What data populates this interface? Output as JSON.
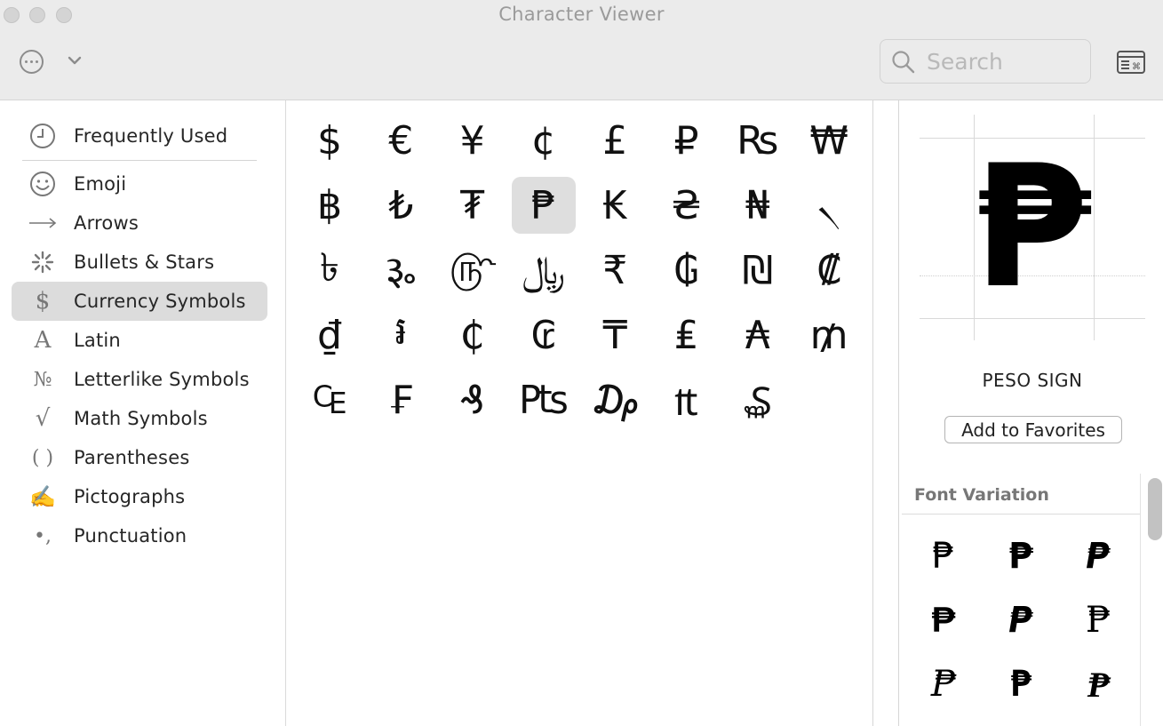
{
  "window": {
    "title": "Character Viewer"
  },
  "toolbar": {
    "action_icon": "ellipsis-circle-icon",
    "chevron_icon": "chevron-down-icon",
    "search_placeholder": "Search",
    "search_value": "",
    "keyboard_icon": "keyboard-viewer-icon"
  },
  "sidebar": {
    "items": [
      {
        "label": "Frequently Used",
        "icon": "clock-icon",
        "glyph": "🕘",
        "selected": false
      },
      {
        "label": "Emoji",
        "icon": "smiley-icon",
        "glyph": "☺",
        "selected": false
      },
      {
        "label": "Arrows",
        "icon": "arrow-right-icon",
        "glyph": "⟶",
        "selected": false
      },
      {
        "label": "Bullets & Stars",
        "icon": "asterisk-icon",
        "glyph": "✻",
        "selected": false
      },
      {
        "label": "Currency Symbols",
        "icon": "dollar-icon",
        "glyph": "$",
        "selected": true
      },
      {
        "label": "Latin",
        "icon": "latin-a-icon",
        "glyph": "A",
        "selected": false
      },
      {
        "label": "Letterlike Symbols",
        "icon": "numero-icon",
        "glyph": "№",
        "selected": false
      },
      {
        "label": "Math Symbols",
        "icon": "square-root-icon",
        "glyph": "√",
        "selected": false
      },
      {
        "label": "Parentheses",
        "icon": "parentheses-icon",
        "glyph": "( )",
        "selected": false
      },
      {
        "label": "Pictographs",
        "icon": "writing-hand-icon",
        "glyph": "✍",
        "selected": false
      },
      {
        "label": "Punctuation",
        "icon": "punctuation-icon",
        "glyph": "•,",
        "selected": false
      }
    ]
  },
  "grid": {
    "characters": [
      "$",
      "€",
      "¥",
      "¢",
      "£",
      "₽",
      "₨",
      "₩",
      "฿",
      "₺",
      "₮",
      "₱",
      "₭",
      "₴",
      "₦",
      "৲",
      "৳",
      "૱",
      "௹",
      "﷼",
      "₹",
      "₲",
      "₪",
      "₡",
      "₫",
      "៛",
      "₵",
      "₢",
      "₸",
      "₤",
      "₳",
      "₥",
      "₠",
      "₣",
      "₰",
      "₧",
      "₯",
      "₶",
      "₷"
    ],
    "selected_index": 11
  },
  "detail": {
    "glyph": "₱",
    "name": "PESO SIGN",
    "add_favorites_label": "Add to Favorites",
    "font_variation_title": "Font Variation",
    "variations": [
      "₱",
      "₱",
      "₱",
      "₱",
      "₱",
      "₱",
      "₱",
      "₱",
      "₱"
    ]
  }
}
